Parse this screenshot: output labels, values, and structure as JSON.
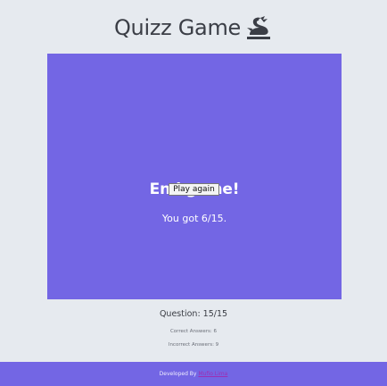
{
  "header": {
    "title": "Quizz Game",
    "logo_icon": "dragon-knight-icon"
  },
  "result": {
    "heading": "End game!",
    "score_text": "You got 6/15.",
    "play_again_label": "Play again"
  },
  "progress": {
    "question_text": "Question: 15/15",
    "correct_text": "Correct Answers: 6",
    "incorrect_text": "Incorrect Answers: 9"
  },
  "footer": {
    "developed_by": "Developed By",
    "author_name": "Mufio Lima"
  },
  "colors": {
    "accent": "#7366e4",
    "background": "#e6eaef",
    "link": "#9d2fb3"
  }
}
